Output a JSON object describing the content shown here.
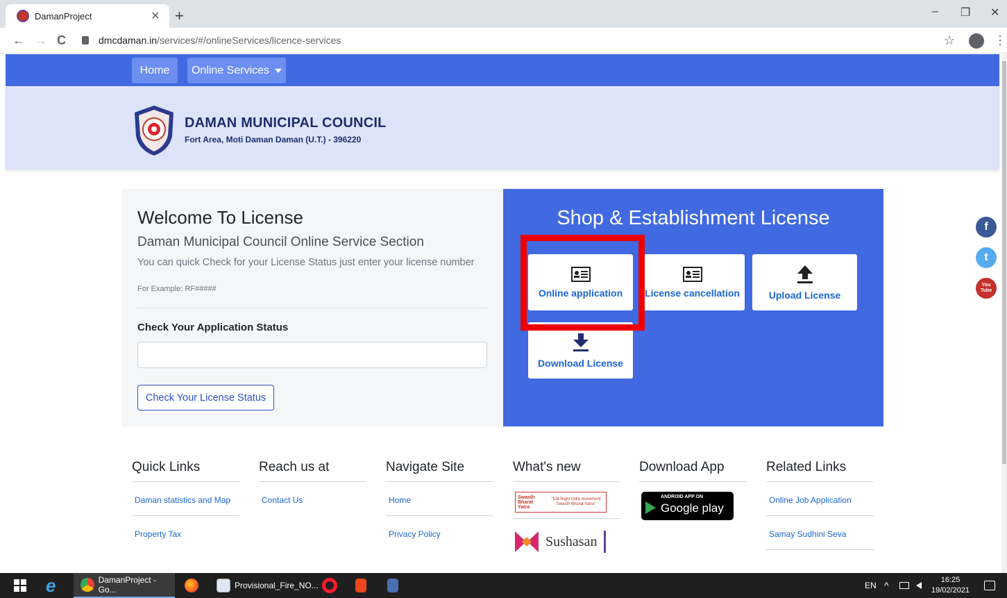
{
  "browser": {
    "tab_title": "DamanProject",
    "tab_close": "✕",
    "new_tab": "+",
    "url_host": "dmcdaman.in",
    "url_path": "/services/#/onlineServices/licence-services",
    "back": "←",
    "forward": "→",
    "reload": "C",
    "star": "☆",
    "menu": "⋮",
    "minimize": "–",
    "maximize": "❐",
    "close": "✕"
  },
  "nav": {
    "home": "Home",
    "online_services": "Online Services"
  },
  "header": {
    "org_name": "DAMAN MUNICIPAL COUNCIL",
    "org_address": "Fort Area, Moti Daman Daman (U.T.) - 396220"
  },
  "welcome": {
    "title": "Welcome To License",
    "subtitle": "Daman Municipal Council Online Service Section",
    "text": "You can quick Check for your License Status just enter your license number",
    "example": "For Example: RF#####",
    "check_label": "Check Your Application Status",
    "input_value": "",
    "button": "Check Your License Status"
  },
  "shop": {
    "title": "Shop & Establishment License",
    "cards": [
      {
        "label": "Online application",
        "icon": "id-card-icon"
      },
      {
        "label": "License cancellation",
        "icon": "id-card-icon"
      },
      {
        "label": "Upload License",
        "icon": "upload-icon"
      },
      {
        "label": "Download License",
        "icon": "download-icon"
      }
    ],
    "highlight_color": "#ee0000"
  },
  "social": {
    "facebook": "f",
    "twitter": "t",
    "youtube_top": "You",
    "youtube_bottom": "Tube"
  },
  "footer": {
    "quick_links": {
      "title": "Quick Links",
      "items": [
        "Daman statistics and Map",
        "Property Tax"
      ]
    },
    "reach_us": {
      "title": "Reach us at",
      "items": [
        "Contact Us"
      ]
    },
    "navigate": {
      "title": "Navigate Site",
      "items": [
        "Home",
        "Privacy Policy"
      ]
    },
    "whats_new": {
      "title": "What's new",
      "badge_left": "Swasth Bharat Yatra",
      "badge_right": "\"Eat Right India movement Swasth Bharat Yatra\"",
      "sushasan": "Sushasan"
    },
    "download_app": {
      "title": "Download App",
      "small": "ANDROID APP ON",
      "big": "Google play"
    },
    "related": {
      "title": "Related Links",
      "items": [
        "Online Job Application",
        "Samay Sudhini Seva"
      ]
    }
  },
  "taskbar": {
    "chrome_label": "DamanProject - Go...",
    "word_label": "Provisional_Fire_NO...",
    "lang": "EN",
    "time": "16:25",
    "date": "19/02/2021"
  },
  "colors": {
    "primary": "#4169e1",
    "header_bg": "#dde4fa",
    "link": "#1a66d4"
  }
}
